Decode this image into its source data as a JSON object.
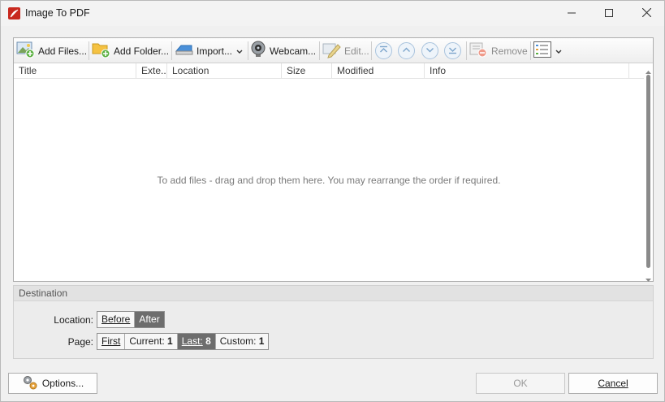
{
  "window": {
    "title": "Image To PDF",
    "controls": [
      "minimize",
      "maximize",
      "close"
    ]
  },
  "toolbar": {
    "add_files": "Add Files...",
    "add_folder": "Add Folder...",
    "import": "Import...",
    "webcam": "Webcam...",
    "edit": "Edit...",
    "remove": "Remove",
    "move_buttons": [
      "move-top-icon",
      "move-up-icon",
      "move-down-icon",
      "move-bottom-icon"
    ],
    "view_menu_icon": "view-list-icon"
  },
  "file_list": {
    "columns": [
      "Title",
      "Exte...",
      "Location",
      "Size",
      "Modified",
      "Info"
    ],
    "empty_message": "To add files - drag and drop them here. You may rearrange the order if required."
  },
  "destination": {
    "heading": "Destination",
    "location_label": "Location:",
    "location_options": [
      "Before",
      "After"
    ],
    "location_selected": "After",
    "page_label": "Page:",
    "page_options": [
      {
        "label": "First",
        "value": ""
      },
      {
        "label": "Current:",
        "value": "1"
      },
      {
        "label": "Last:",
        "value": "8"
      },
      {
        "label": "Custom:",
        "value": "1"
      }
    ],
    "page_selected": "Last:"
  },
  "footer": {
    "options": "Options...",
    "ok": "OK",
    "cancel": "Cancel"
  },
  "colors": {
    "app_icon": "#c8281e",
    "selected_segment": "#6d6d6d",
    "window_bg": "#f0f0f0"
  }
}
